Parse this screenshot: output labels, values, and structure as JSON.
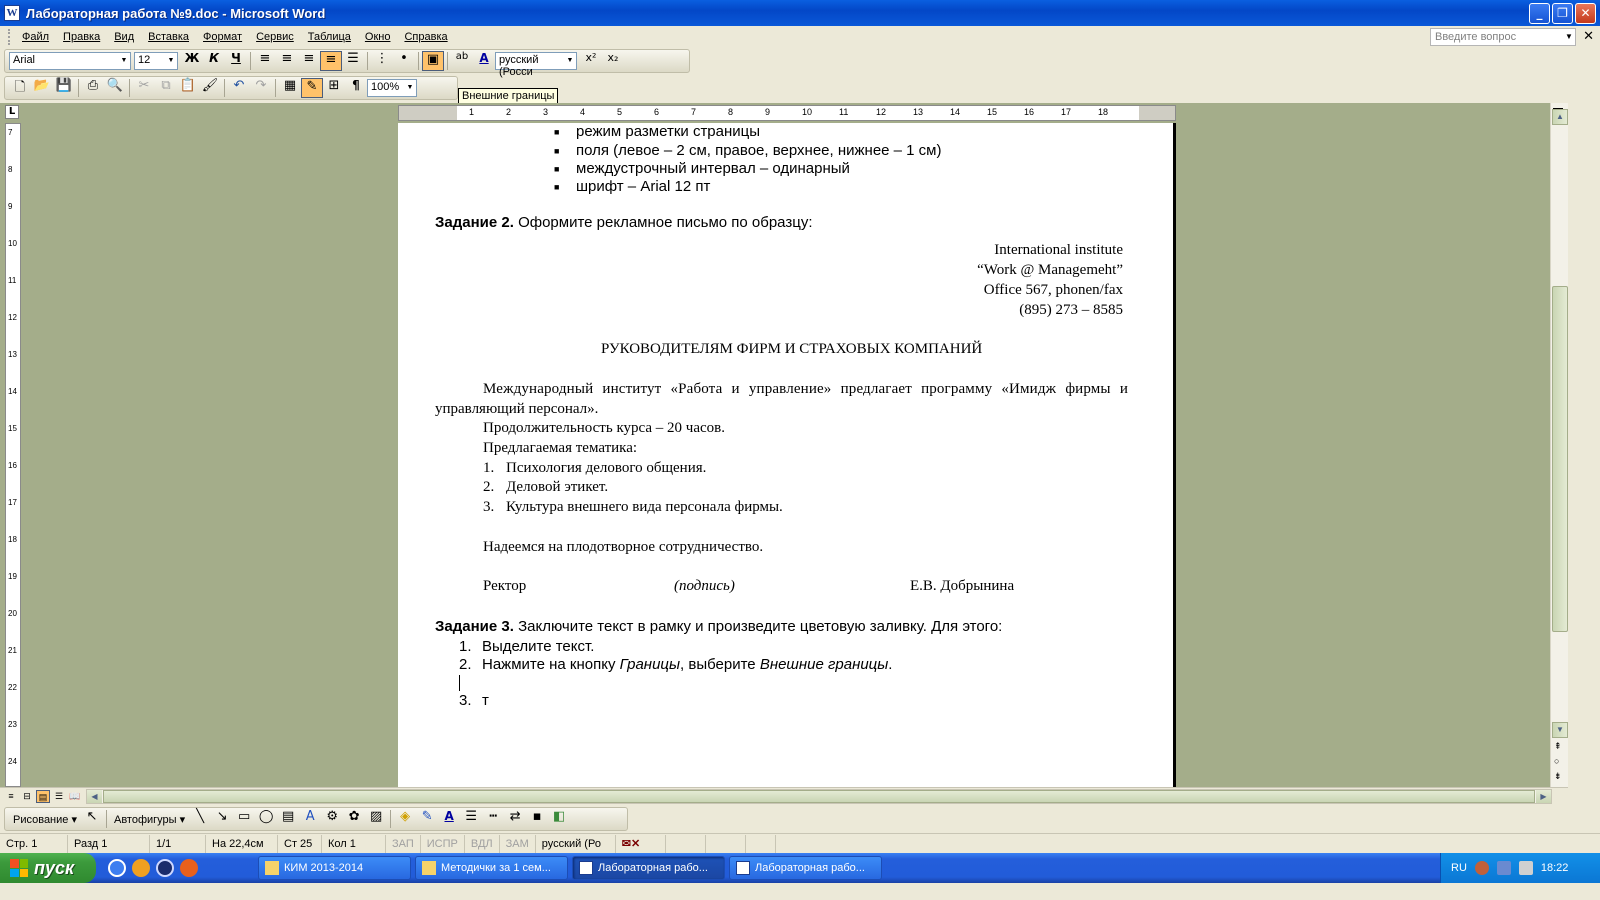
{
  "window": {
    "title": "Лабораторная работа №9.doc - Microsoft Word",
    "app_icon": "W",
    "minimize": "_",
    "maximize": "❐",
    "close": "✕"
  },
  "menu": {
    "items": [
      "Файл",
      "Правка",
      "Вид",
      "Вставка",
      "Формат",
      "Сервис",
      "Таблица",
      "Окно",
      "Справка"
    ],
    "help_placeholder": "Введите вопрос",
    "doc_close": "✕"
  },
  "formatting": {
    "font": "Arial",
    "size": "12",
    "bold": "Ж",
    "italic": "К",
    "underline": "Ч",
    "language": "русский (Росси",
    "superscript": "x²",
    "subscript": "x₂",
    "font_color": "A",
    "highlight": "ab"
  },
  "standard": {
    "zoom": "100%",
    "pilcrow": "¶"
  },
  "tooltip": "Внешние границы",
  "ruler": {
    "horizontal_labels": [
      "1",
      "2",
      "3",
      "4",
      "5",
      "6",
      "7",
      "8",
      "9",
      "10",
      "11",
      "12",
      "13",
      "14",
      "15",
      "16",
      "17",
      "18"
    ],
    "vertical_labels": [
      "7",
      "8",
      "9",
      "10",
      "11",
      "12",
      "13",
      "14",
      "15",
      "16",
      "17",
      "18",
      "19",
      "20",
      "21",
      "22",
      "23",
      "24"
    ]
  },
  "document": {
    "bullets": [
      "режим разметки страницы",
      "поля (левое – 2 см, правое, верхнее, нижнее – 1 см)",
      "междустрочный интервал – одинарный",
      "шрифт – Arial 12 пт"
    ],
    "task2_label": "Задание 2.",
    "task2_text": " Оформите рекламное письмо по образцу:",
    "address": [
      "International institute",
      "“Work @ Managemeht”",
      "Office 567, phonen/fax",
      "(895) 273 – 8585"
    ],
    "heading": "РУКОВОДИТЕЛЯМ ФИРМ И СТРАХОВЫХ КОМПАНИЙ",
    "para1_line1": "Международный институт «Работа и управление» предлагает программу «Имидж фирмы и",
    "para1_line2": "управляющий персонал».",
    "duration": "Продолжительность курса – 20 часов.",
    "topics_title": "Предлагаемая тематика:",
    "topics": [
      {
        "num": "1.",
        "text": "Психология делового общения."
      },
      {
        "num": "2.",
        "text": "Деловой этикет."
      },
      {
        "num": "3.",
        "text": "Культура внешнего вида персонала фирмы."
      }
    ],
    "closing": "Надеемся на плодотворное сотрудничество.",
    "sign_role": "Ректор",
    "sign_mark": "(подпись)",
    "sign_name": "Е.В. Добрынина",
    "task3_label": "Задание 3.",
    "task3_text": " Заключите текст в рамку и произведите цветовую заливку. Для этого:",
    "steps": [
      {
        "num": "1.",
        "text": "Выделите текст."
      },
      {
        "num": "2.",
        "pre": "Нажмите на кнопку ",
        "em1": "Границы",
        "mid": ", выберите ",
        "em2": "Внешние границы",
        "post": "."
      },
      {
        "num": "3.",
        "text": "т"
      }
    ]
  },
  "drawing": {
    "draw_menu": "Рисование ▾",
    "autoshapes": "Автофигуры ▾"
  },
  "status": {
    "page": "Стр. 1",
    "section": "Разд 1",
    "pages": "1/1",
    "at": "На 22,4см",
    "line": "Ст 25",
    "col": "Кол 1",
    "rec": "ЗАП",
    "trk": "ИСПР",
    "ext": "ВДЛ",
    "ovr": "ЗАМ",
    "language": "русский (Ро"
  },
  "taskbar": {
    "start": "пуск",
    "tasks": [
      "КИМ 2013-2014",
      "Методички за 1 сем...",
      "Лабораторная рабо...",
      "Лабораторная рабо..."
    ],
    "lang": "RU",
    "clock": "18:22"
  },
  "colors": {
    "titlebar": "#0a5fe0",
    "workspace": "#a4ad8a",
    "highlight_btn": "#ffc26a",
    "taskbar": "#245edb",
    "start": "#3c9a3c"
  }
}
